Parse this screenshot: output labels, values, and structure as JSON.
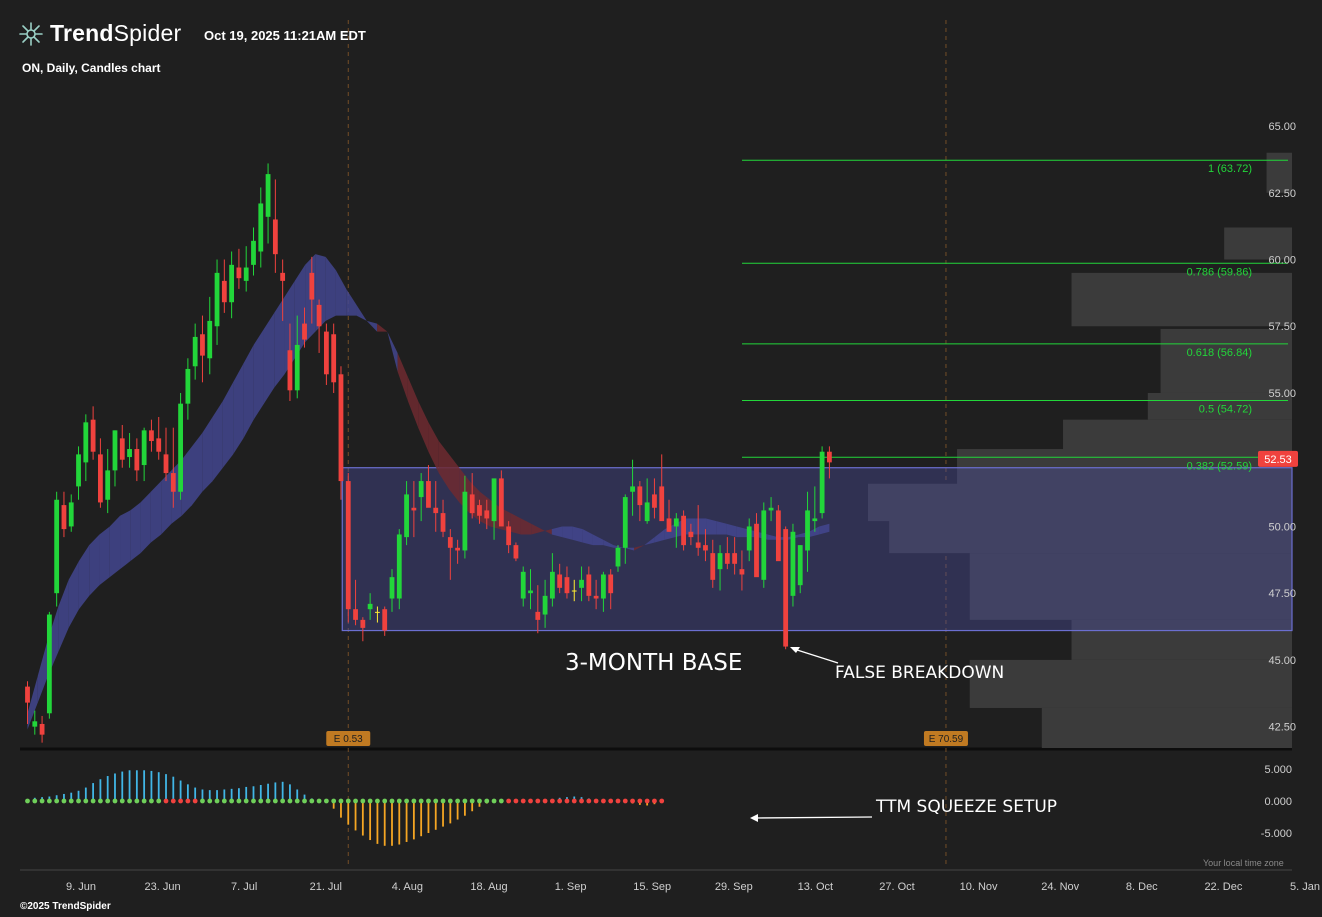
{
  "header": {
    "brand_bold": "Trend",
    "brand_light": "Spider",
    "timestamp": "Oct 19, 2025 11:21AM EDT",
    "subtitle": "ON, Daily, Candles chart",
    "copyright": "©2025 TrendSpider",
    "timezone_note": "Your local time zone",
    "logo_icon": "spider-logo-icon"
  },
  "chart_data": {
    "type": "candlestick",
    "symbol": "ON",
    "timeframe": "Daily",
    "ylim": [
      41.7,
      66.8
    ],
    "y_ticks": [
      "65.00",
      "62.50",
      "60.00",
      "57.50",
      "55.00",
      "52.50",
      "50.00",
      "47.50",
      "45.00",
      "42.50"
    ],
    "x_ticks": [
      "9. Jun",
      "23. Jun",
      "7. Jul",
      "21. Jul",
      "4. Aug",
      "18. Aug",
      "1. Sep",
      "15. Sep",
      "29. Sep",
      "13. Oct",
      "27. Oct",
      "10. Nov",
      "24. Nov",
      "8. Dec",
      "22. Dec",
      "5. Jan"
    ],
    "last_price": "52.53",
    "colors": {
      "up": "#22d63a",
      "down": "#f0423e",
      "doji": "#ffee33",
      "fib": "#22d63a",
      "box": "#4b4ea6",
      "ribbon": "#43468f",
      "ribbon_down": "#6e2a30",
      "squeeze_pos": "#41b6e6",
      "squeeze_neg": "#f5a623",
      "dot_on": "#f0423e",
      "dot_off": "#6fcf5a",
      "last_price_bg": "#f0423e",
      "earnings_bg": "#c07a22"
    },
    "candles": [
      [
        44.0,
        44.2,
        42.6,
        43.4
      ],
      [
        42.5,
        43.1,
        42.2,
        42.7
      ],
      [
        42.6,
        42.9,
        41.9,
        42.2
      ],
      [
        43.0,
        46.8,
        42.8,
        46.7
      ],
      [
        47.5,
        51.3,
        47.0,
        51.0
      ],
      [
        50.8,
        51.3,
        49.6,
        49.9
      ],
      [
        50.0,
        51.2,
        49.8,
        50.9
      ],
      [
        51.5,
        53.0,
        51.0,
        52.7
      ],
      [
        52.4,
        54.2,
        51.7,
        53.9
      ],
      [
        54.0,
        54.5,
        52.5,
        52.8
      ],
      [
        52.7,
        53.3,
        50.7,
        50.9
      ],
      [
        51.0,
        52.9,
        50.5,
        52.1
      ],
      [
        52.1,
        53.6,
        51.5,
        53.6
      ],
      [
        53.3,
        53.8,
        52.2,
        52.5
      ],
      [
        52.6,
        53.5,
        52.2,
        52.9
      ],
      [
        52.9,
        53.3,
        51.7,
        52.1
      ],
      [
        52.3,
        53.7,
        51.7,
        53.6
      ],
      [
        53.6,
        54.0,
        52.8,
        53.2
      ],
      [
        53.3,
        54.1,
        52.5,
        52.8
      ],
      [
        52.7,
        53.7,
        51.7,
        52.0
      ],
      [
        52.0,
        53.7,
        50.7,
        51.3
      ],
      [
        51.3,
        55.0,
        51.0,
        54.6
      ],
      [
        54.6,
        56.3,
        54.0,
        55.9
      ],
      [
        56.0,
        57.6,
        55.5,
        57.1
      ],
      [
        57.2,
        57.9,
        55.4,
        56.4
      ],
      [
        56.3,
        58.6,
        55.7,
        57.7
      ],
      [
        57.5,
        60.0,
        56.8,
        59.5
      ],
      [
        59.2,
        60.0,
        58.0,
        58.4
      ],
      [
        58.4,
        60.3,
        57.8,
        59.8
      ],
      [
        59.7,
        60.4,
        58.9,
        59.3
      ],
      [
        59.2,
        60.5,
        58.8,
        59.7
      ],
      [
        59.8,
        61.2,
        59.4,
        60.7
      ],
      [
        60.3,
        62.7,
        59.7,
        62.1
      ],
      [
        61.6,
        63.6,
        60.6,
        63.2
      ],
      [
        61.5,
        63.0,
        59.5,
        60.2
      ],
      [
        59.5,
        60.0,
        57.7,
        59.2
      ],
      [
        56.6,
        57.6,
        54.7,
        55.1
      ],
      [
        55.1,
        57.9,
        54.8,
        56.8
      ],
      [
        57.6,
        58.2,
        56.7,
        57.0
      ],
      [
        59.5,
        60.1,
        57.6,
        58.5
      ],
      [
        58.3,
        58.5,
        56.5,
        57.5
      ],
      [
        57.3,
        57.6,
        55.3,
        55.7
      ],
      [
        57.2,
        57.6,
        55.0,
        55.4
      ],
      [
        55.7,
        56.0,
        51.0,
        51.7
      ],
      [
        51.7,
        52.0,
        46.4,
        46.9
      ],
      [
        46.9,
        48.0,
        46.3,
        46.5
      ],
      [
        46.5,
        46.6,
        45.7,
        46.2
      ],
      [
        46.9,
        47.5,
        46.5,
        47.1
      ],
      [
        46.8,
        47.0,
        46.4,
        46.8
      ],
      [
        46.9,
        47.0,
        45.9,
        46.1
      ],
      [
        47.3,
        48.4,
        46.8,
        48.1
      ],
      [
        47.3,
        49.9,
        46.9,
        49.7
      ],
      [
        49.6,
        51.7,
        49.3,
        51.2
      ],
      [
        50.7,
        51.7,
        49.6,
        50.6
      ],
      [
        51.1,
        52.0,
        50.2,
        51.7
      ],
      [
        51.7,
        52.3,
        50.8,
        50.7
      ],
      [
        50.7,
        51.7,
        49.8,
        50.5
      ],
      [
        50.5,
        51.0,
        49.6,
        49.8
      ],
      [
        49.6,
        49.9,
        48.0,
        49.2
      ],
      [
        49.2,
        49.5,
        48.6,
        49.1
      ],
      [
        49.1,
        51.9,
        48.8,
        51.3
      ],
      [
        51.2,
        52.0,
        50.3,
        50.5
      ],
      [
        50.8,
        51.0,
        50.1,
        50.4
      ],
      [
        50.6,
        51.0,
        49.9,
        50.3
      ],
      [
        50.2,
        51.8,
        49.5,
        51.8
      ],
      [
        51.8,
        52.1,
        50.1,
        50.0
      ],
      [
        50.0,
        50.2,
        49.0,
        49.3
      ],
      [
        49.3,
        49.4,
        48.7,
        48.8
      ],
      [
        47.3,
        48.5,
        47.0,
        48.3
      ],
      [
        47.5,
        48.4,
        46.9,
        47.6
      ],
      [
        46.8,
        47.8,
        46.0,
        46.5
      ],
      [
        46.7,
        48.0,
        46.2,
        47.4
      ],
      [
        47.3,
        49.0,
        47.0,
        48.3
      ],
      [
        48.2,
        48.6,
        47.5,
        47.7
      ],
      [
        48.1,
        48.5,
        47.3,
        47.5
      ],
      [
        47.6,
        48.0,
        47.2,
        47.6
      ],
      [
        47.7,
        48.5,
        47.2,
        48.0
      ],
      [
        48.2,
        48.5,
        47.2,
        47.4
      ],
      [
        47.4,
        48.0,
        46.9,
        47.3
      ],
      [
        47.3,
        48.3,
        46.8,
        48.2
      ],
      [
        48.2,
        48.4,
        46.9,
        47.5
      ],
      [
        48.5,
        49.3,
        48.3,
        49.2
      ],
      [
        49.2,
        51.2,
        48.6,
        51.1
      ],
      [
        51.3,
        52.5,
        50.4,
        51.5
      ],
      [
        51.5,
        51.7,
        50.2,
        50.8
      ],
      [
        50.2,
        51.8,
        50.1,
        50.9
      ],
      [
        51.2,
        51.8,
        50.3,
        50.7
      ],
      [
        51.5,
        52.7,
        51.0,
        50.2
      ],
      [
        50.3,
        51.0,
        49.8,
        49.8
      ],
      [
        50.0,
        50.5,
        49.2,
        50.3
      ],
      [
        50.4,
        50.6,
        49.1,
        49.3
      ],
      [
        49.8,
        50.1,
        49.3,
        49.6
      ],
      [
        49.4,
        50.8,
        48.9,
        49.2
      ],
      [
        49.3,
        49.9,
        48.7,
        49.1
      ],
      [
        49.0,
        49.5,
        47.7,
        48.0
      ],
      [
        48.4,
        49.3,
        47.6,
        49.0
      ],
      [
        49.0,
        49.6,
        48.4,
        48.6
      ],
      [
        49.0,
        49.6,
        48.2,
        48.6
      ],
      [
        48.4,
        49.1,
        47.6,
        48.2
      ],
      [
        49.1,
        50.3,
        48.7,
        50.0
      ],
      [
        50.1,
        50.5,
        48.3,
        48.1
      ],
      [
        48.0,
        50.9,
        47.7,
        50.6
      ],
      [
        50.6,
        51.1,
        50.2,
        50.7
      ],
      [
        50.6,
        50.8,
        48.8,
        48.7
      ],
      [
        49.9,
        50.0,
        45.4,
        45.5
      ],
      [
        47.4,
        50.1,
        47.0,
        49.8
      ],
      [
        47.8,
        49.3,
        47.5,
        49.3
      ],
      [
        49.1,
        51.3,
        48.3,
        50.6
      ],
      [
        50.2,
        51.5,
        49.8,
        50.3
      ],
      [
        50.5,
        53.0,
        50.3,
        52.8
      ],
      [
        52.8,
        53.0,
        51.8,
        52.4
      ]
    ],
    "fib_levels": [
      {
        "label": "1 (63.72)",
        "value": 63.72
      },
      {
        "label": "0.786 (59.86)",
        "value": 59.86
      },
      {
        "label": "0.618 (56.84)",
        "value": 56.84
      },
      {
        "label": "0.5 (54.72)",
        "value": 54.72
      },
      {
        "label": "0.382 (52.59)",
        "value": 52.59
      }
    ],
    "base_box": {
      "start_index": 44,
      "end": "13. Nov",
      "low": 46.1,
      "high": 52.2
    },
    "volume_profile": [
      {
        "low": 62.5,
        "high": 64.0,
        "size": 0.06
      },
      {
        "low": 60.0,
        "high": 61.2,
        "size": 0.16
      },
      {
        "low": 57.5,
        "high": 59.5,
        "size": 0.52
      },
      {
        "low": 55.0,
        "high": 57.4,
        "size": 0.31
      },
      {
        "low": 54.0,
        "high": 55.0,
        "size": 0.34
      },
      {
        "low": 52.0,
        "high": 54.0,
        "size": 0.54
      },
      {
        "low": 51.3,
        "high": 52.9,
        "size": 0.79
      },
      {
        "low": 50.2,
        "high": 51.6,
        "size": 1.0
      },
      {
        "low": 49.0,
        "high": 50.3,
        "size": 0.95
      },
      {
        "low": 46.5,
        "high": 49.0,
        "size": 0.76
      },
      {
        "low": 45.0,
        "high": 46.5,
        "size": 0.52
      },
      {
        "low": 43.2,
        "high": 45.0,
        "size": 0.76
      },
      {
        "low": 41.7,
        "high": 43.2,
        "size": 0.59
      }
    ],
    "ribbon": {
      "fast": [
        43.0,
        44.4,
        45.8,
        47.0,
        48.0,
        48.7,
        49.3,
        49.7,
        50.0,
        50.4,
        50.6,
        50.9,
        51.3,
        51.7,
        52.1,
        52.5,
        53.0,
        53.5,
        54.1,
        54.7,
        55.4,
        56.1,
        56.8,
        57.4,
        58.0,
        58.6,
        59.2,
        59.8,
        60.2,
        60.1,
        59.6,
        58.9,
        58.3,
        57.7,
        57.3,
        57.3,
        55.8,
        54.7,
        53.7,
        52.8,
        52.0,
        51.4,
        50.9,
        50.5,
        50.2,
        50.0,
        49.9,
        49.8,
        49.7,
        49.7,
        49.8,
        49.9,
        50.0,
        50.0,
        49.9,
        49.7,
        49.5,
        49.3,
        49.2,
        49.1,
        49.3,
        49.6,
        49.9,
        50.1,
        50.3,
        50.3,
        50.3,
        50.2,
        50.1,
        50.0,
        49.9,
        49.8,
        49.7,
        49.6,
        49.6,
        49.7,
        49.8,
        50.0,
        50.1
      ],
      "slow": [
        42.4,
        43.4,
        44.4,
        45.3,
        46.2,
        46.9,
        47.4,
        47.8,
        48.1,
        48.4,
        48.7,
        49.0,
        49.4,
        49.7,
        50.1,
        50.4,
        50.8,
        51.3,
        51.7,
        52.2,
        52.7,
        53.3,
        54.0,
        54.6,
        55.2,
        55.7,
        56.3,
        56.9,
        57.3,
        57.7,
        57.9,
        57.9,
        57.9,
        57.7,
        57.6,
        57.3,
        56.5,
        55.6,
        54.7,
        53.9,
        53.2,
        52.7,
        52.2,
        51.7,
        51.3,
        51.0,
        50.7,
        50.5,
        50.3,
        50.1,
        49.9,
        49.7,
        49.6,
        49.5,
        49.4,
        49.3,
        49.3,
        49.2,
        49.2,
        49.2,
        49.3,
        49.4,
        49.5,
        49.6,
        49.7,
        49.7,
        49.7,
        49.7,
        49.7,
        49.6,
        49.6,
        49.6,
        49.5,
        49.5,
        49.5,
        49.6,
        49.6,
        49.7,
        49.8
      ]
    },
    "earnings": [
      {
        "label": "E 0.53",
        "x_index": 44
      },
      {
        "label": "E 70.59",
        "at": "1. Nov"
      }
    ],
    "squeeze": {
      "y_ticks": [
        "5.000",
        "0.000",
        "-5.000"
      ],
      "ylim": [
        -7.5,
        5.5
      ],
      "values": [
        0.3,
        0.5,
        0.6,
        0.7,
        0.9,
        1.1,
        1.3,
        1.6,
        2.1,
        2.8,
        3.4,
        3.9,
        4.3,
        4.6,
        4.8,
        4.8,
        4.8,
        4.7,
        4.5,
        4.2,
        3.8,
        3.2,
        2.6,
        2.1,
        1.8,
        1.7,
        1.7,
        1.8,
        1.9,
        2.0,
        2.2,
        2.3,
        2.5,
        2.7,
        2.9,
        3.0,
        2.6,
        1.8,
        1.0,
        0.4,
        0.1,
        -0.2,
        -1.2,
        -2.6,
        -3.7,
        -4.6,
        -5.4,
        -6.1,
        -6.7,
        -7.0,
        -7.0,
        -6.8,
        -6.4,
        -6.0,
        -5.5,
        -5.0,
        -4.5,
        -4.0,
        -3.5,
        -2.9,
        -2.3,
        -1.6,
        -0.9,
        -0.4,
        -0.1,
        0.1,
        0.2,
        0.2,
        0.1,
        0.1,
        0.1,
        0.2,
        0.3,
        0.5,
        0.6,
        0.7,
        0.6,
        0.4,
        0.3,
        0.2,
        0.1,
        0.0,
        -0.2,
        -0.4,
        -0.6,
        -0.7,
        -0.5,
        -0.3
      ],
      "squeeze_on_ranges": [
        [
          19,
          23
        ],
        [
          66,
          110
        ]
      ]
    },
    "annotations": [
      {
        "text": "3-MONTH BASE"
      },
      {
        "text": "FALSE BREAKDOWN"
      },
      {
        "text": "TTM SQUEEZE SETUP"
      }
    ]
  }
}
